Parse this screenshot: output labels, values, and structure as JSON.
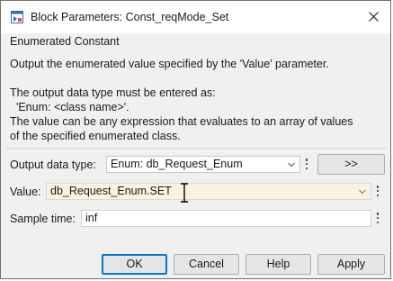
{
  "window": {
    "title": "Block Parameters: Const_reqMode_Set",
    "close_icon": "close-icon",
    "app_icon": "simulink-block-icon"
  },
  "group": {
    "title": "Enumerated Constant",
    "description": "Output the enumerated value specified by the 'Value' parameter.\n\nThe output data type must be entered as:\n  'Enum: <class name>'.\nThe value can be any expression that evaluates to an array of values\nof the specified enumerated class."
  },
  "params": {
    "output_data_type": {
      "label": "Output data type:",
      "value": "Enum: db_Request_Enum",
      "assistant_label": ">>"
    },
    "value": {
      "label": "Value:",
      "value": "db_Request_Enum.SET"
    },
    "sample_time": {
      "label": "Sample time:",
      "value": "inf"
    }
  },
  "buttons": {
    "ok": "OK",
    "cancel": "Cancel",
    "help": "Help",
    "apply": "Apply"
  },
  "colors": {
    "value_field_bg": "#fbf1df",
    "focus_border": "#0078d7"
  }
}
